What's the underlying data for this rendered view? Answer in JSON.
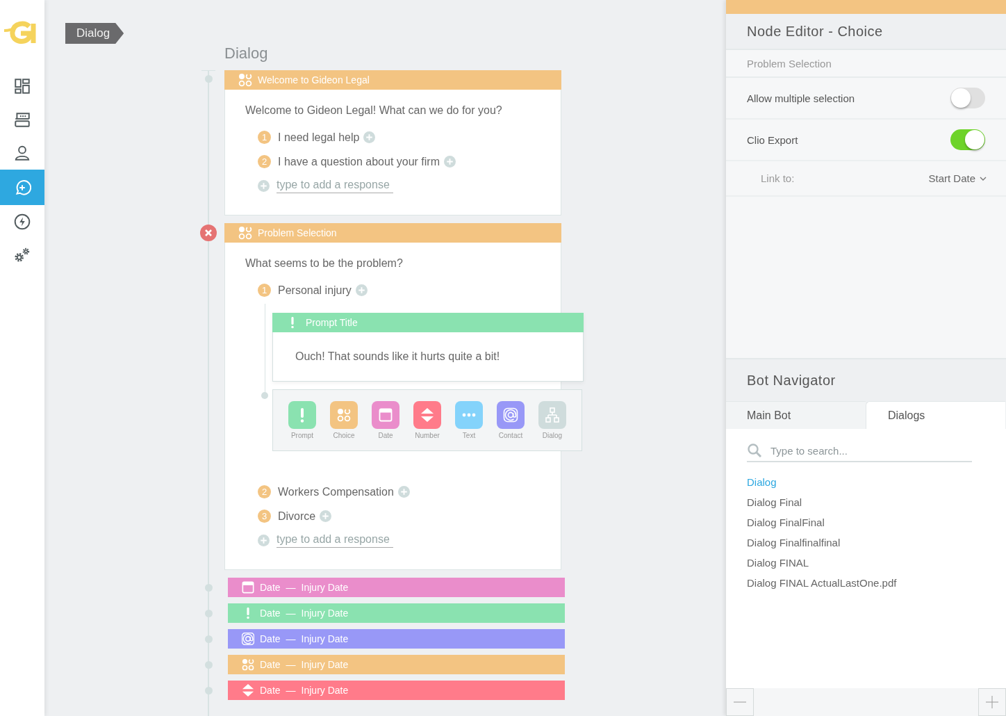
{
  "sidebar": {
    "items": [
      {
        "kind": "dashboard",
        "selected": false
      },
      {
        "kind": "bots",
        "selected": false
      },
      {
        "kind": "users",
        "selected": false
      },
      {
        "kind": "dialogs",
        "selected": true
      },
      {
        "kind": "integrations",
        "selected": false
      },
      {
        "kind": "settings",
        "selected": false
      }
    ]
  },
  "breadcrumb": "Dialog",
  "canvas": {
    "title": "Dialog",
    "nodes": [
      {
        "kind": "choice",
        "expanded": true,
        "selected": false,
        "title": "Welcome to Gideon Legal",
        "question": "Welcome to Gideon Legal! What can we do for you?",
        "responses": [
          {
            "number": "1",
            "label": "I need legal help"
          },
          {
            "number": "2",
            "label": "I have a question about your firm"
          }
        ],
        "add_placeholder": "type to add a response"
      },
      {
        "kind": "choice",
        "expanded": true,
        "selected": true,
        "title": "Problem Selection",
        "question": "What seems to be the problem?",
        "responses": [
          {
            "number": "1",
            "label": "Personal injury",
            "children": [
              {
                "kind": "prompt",
                "title": "Prompt Title",
                "message": "Ouch! That sounds like it hurts quite a bit!"
              }
            ],
            "palette": [
              {
                "kind": "prompt",
                "label": "Prompt"
              },
              {
                "kind": "choice",
                "label": "Choice"
              },
              {
                "kind": "date",
                "label": "Date"
              },
              {
                "kind": "number",
                "label": "Number"
              },
              {
                "kind": "text",
                "label": "Text"
              },
              {
                "kind": "contact",
                "label": "Contact"
              },
              {
                "kind": "dialog",
                "label": "Dialog"
              }
            ]
          },
          {
            "number": "2",
            "label": "Workers Compensation"
          },
          {
            "number": "3",
            "label": "Divorce"
          }
        ],
        "add_placeholder": "type to add a response"
      },
      {
        "kind": "date",
        "expanded": false,
        "selected": false,
        "title": "Date",
        "separator": "—",
        "subtitle": "Injury Date"
      },
      {
        "kind": "prompt",
        "expanded": false,
        "selected": false,
        "title": "Date",
        "separator": "—",
        "subtitle": "Injury Date"
      },
      {
        "kind": "contact",
        "expanded": false,
        "selected": false,
        "title": "Date",
        "separator": "—",
        "subtitle": "Injury Date"
      },
      {
        "kind": "choice",
        "expanded": false,
        "selected": false,
        "title": "Date",
        "separator": "—",
        "subtitle": "Injury Date"
      },
      {
        "kind": "number",
        "expanded": false,
        "selected": false,
        "title": "Date",
        "separator": "—",
        "subtitle": "Injury Date"
      }
    ]
  },
  "editor": {
    "title": "Node Editor - Choice",
    "node_name": "Problem Selection",
    "settings": [
      {
        "label": "Allow multiple selection",
        "on": false
      },
      {
        "label": "Clio Export",
        "on": true
      }
    ],
    "link": {
      "label": "Link to:",
      "value": "Start Date"
    }
  },
  "navigator": {
    "title": "Bot Navigator",
    "tabs": [
      {
        "label": "Main Bot",
        "selected": false
      },
      {
        "label": "Dialogs",
        "selected": true
      }
    ],
    "search": {
      "placeholder": "Type to search..."
    },
    "items": [
      {
        "label": "Dialog",
        "selected": true
      },
      {
        "label": "Dialog Final",
        "selected": false
      },
      {
        "label": "Dialog FinalFinal",
        "selected": false
      },
      {
        "label": "Dialog Finalfinalfinal",
        "selected": false
      },
      {
        "label": "Dialog FINAL",
        "selected": false
      },
      {
        "label": "Dialog FINAL ActualLastOne.pdf",
        "selected": false
      }
    ]
  }
}
